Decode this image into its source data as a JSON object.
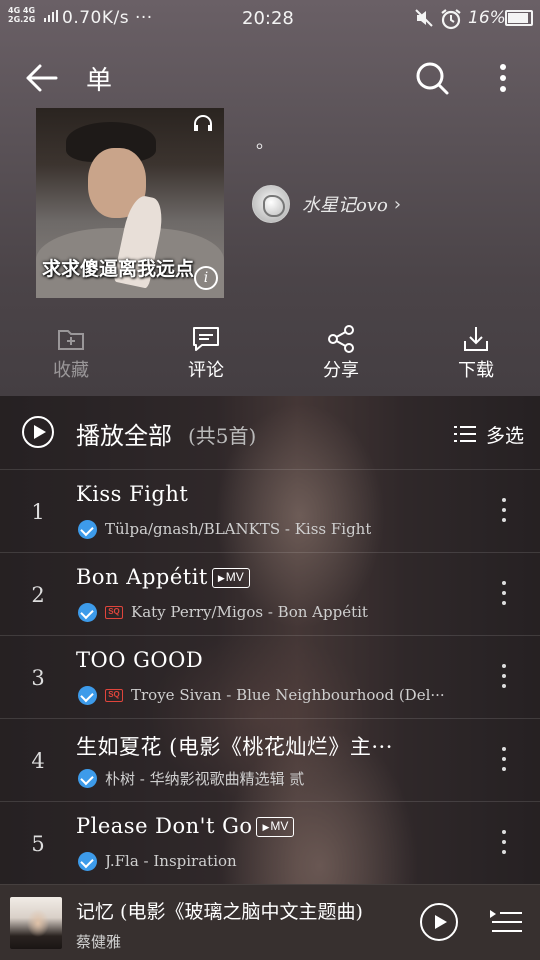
{
  "status_bar": {
    "network_label": "4G 4G\n26.26",
    "speed": "0.70K/s",
    "dots": "···",
    "time": "20:28",
    "battery": "16%"
  },
  "header": {
    "title": "单",
    "back_icon": "arrow-left-icon",
    "search_icon": "search-icon",
    "more_icon": "more-vertical-icon"
  },
  "playlist": {
    "cover_caption": "求求傻逼离我远点",
    "description": "。",
    "creator_name": "水星记ovo",
    "creator_chevron": "›"
  },
  "actions": [
    {
      "label": "收藏",
      "icon": "folder-icon",
      "enabled": false
    },
    {
      "label": "评论",
      "icon": "comment-icon",
      "enabled": true
    },
    {
      "label": "分享",
      "icon": "share-icon",
      "enabled": true
    },
    {
      "label": "下载",
      "icon": "download-icon",
      "enabled": true
    }
  ],
  "play_all": {
    "label": "播放全部",
    "count": "(共5首)",
    "multi_select": "多选"
  },
  "songs": [
    {
      "index": "1",
      "title": "Kiss Fight",
      "mv": "",
      "sq": false,
      "meta": "Tülpa/gnash/BLANKTS - Kiss Fight"
    },
    {
      "index": "2",
      "title": "Bon Appétit",
      "mv": "MV",
      "sq": true,
      "meta": "Katy Perry/Migos - Bon Appétit"
    },
    {
      "index": "3",
      "title": "TOO GOOD",
      "mv": "",
      "sq": true,
      "meta": "Troye Sivan - Blue Neighbourhood (Del···"
    },
    {
      "index": "4",
      "title": "生如夏花 (电影《桃花灿烂》主···",
      "mv": "",
      "sq": false,
      "meta": "朴树 - 华纳影视歌曲精选辑 贰"
    },
    {
      "index": "5",
      "title": "Please Don't Go",
      "mv": "MV",
      "sq": false,
      "meta": "J.Fla - Inspiration"
    }
  ],
  "mini_player": {
    "title": "记忆 (电影《玻璃之脑中文主题曲)",
    "artist": "蔡健雅",
    "play_icon": "play-circle-icon",
    "queue_icon": "playlist-queue-icon"
  },
  "colors": {
    "verified": "#3d9bea",
    "sq_badge": "#e0453c"
  }
}
